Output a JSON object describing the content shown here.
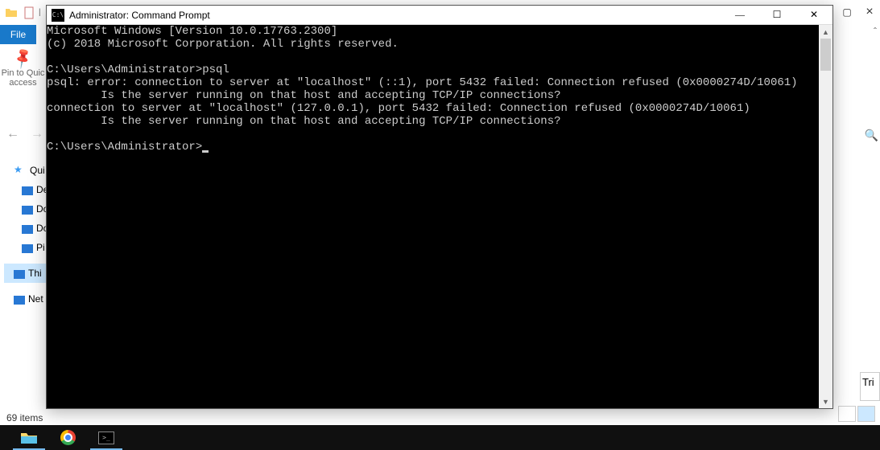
{
  "explorer": {
    "file_tab": "File",
    "pin_label_1": "Pin to Quic",
    "pin_label_2": "access",
    "sidebar": [
      {
        "label": "Qui"
      },
      {
        "label": "De"
      },
      {
        "label": "Do"
      },
      {
        "label": "Do"
      },
      {
        "label": "Pi"
      },
      {
        "label": "Thi"
      },
      {
        "label": "Net"
      }
    ],
    "status": "69 items",
    "trial": "Tri"
  },
  "cmd": {
    "title": "Administrator: Command Prompt",
    "lines": [
      "Microsoft Windows [Version 10.0.17763.2300]",
      "(c) 2018 Microsoft Corporation. All rights reserved.",
      "",
      "C:\\Users\\Administrator>psql",
      "psql: error: connection to server at \"localhost\" (::1), port 5432 failed: Connection refused (0x0000274D/10061)",
      "        Is the server running on that host and accepting TCP/IP connections?",
      "connection to server at \"localhost\" (127.0.0.1), port 5432 failed: Connection refused (0x0000274D/10061)",
      "        Is the server running on that host and accepting TCP/IP connections?",
      "",
      "C:\\Users\\Administrator>"
    ]
  }
}
